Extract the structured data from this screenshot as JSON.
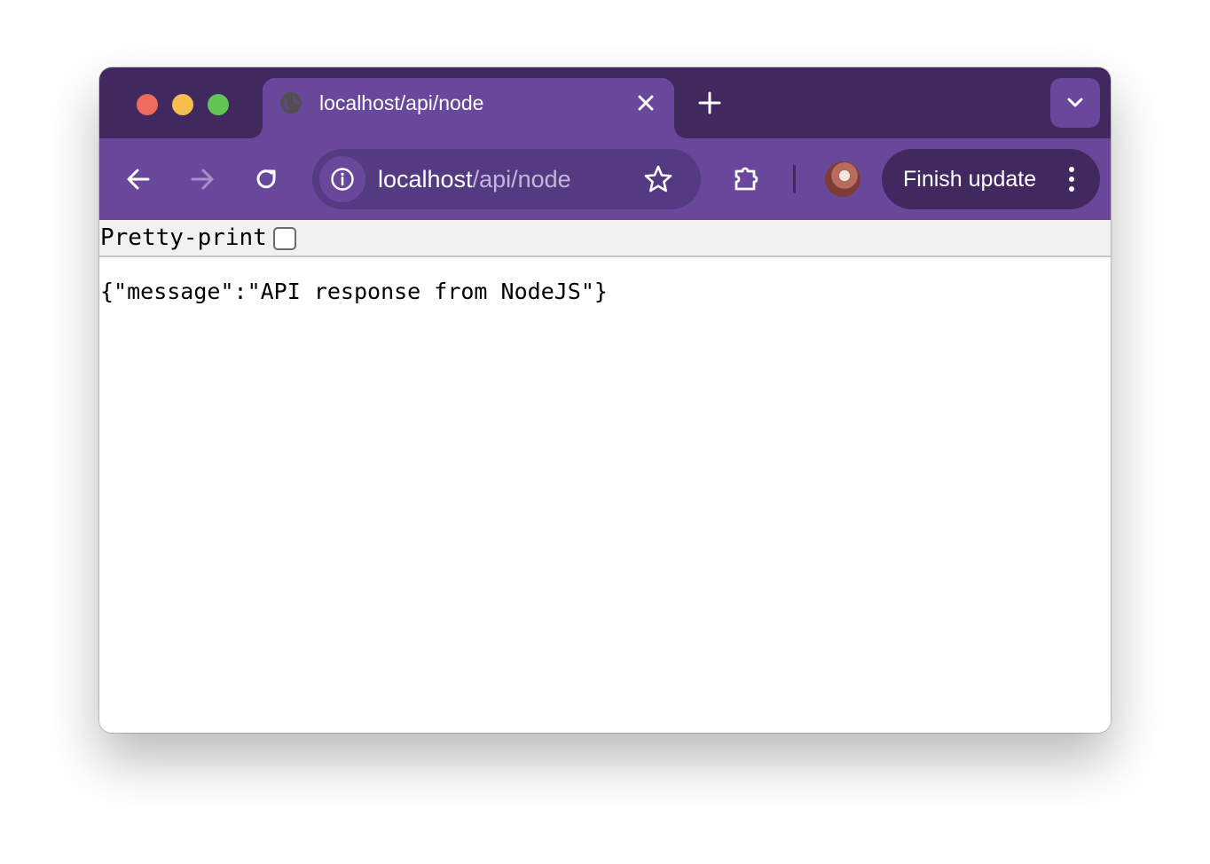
{
  "browser": {
    "tab": {
      "title": "localhost/api/node",
      "favicon": "globe-icon",
      "close_icon": "close-icon"
    },
    "new_tab_icon": "plus-icon",
    "tab_search_icon": "chevron-down-icon",
    "toolbar": {
      "back_icon": "arrow-left-icon",
      "forward_icon": "arrow-right-icon",
      "reload_icon": "reload-icon",
      "site_info_icon": "info-icon",
      "url_host": "localhost",
      "url_path": "/api/node",
      "bookmark_icon": "star-icon",
      "extensions_icon": "puzzle-icon",
      "profile_icon": "avatar",
      "update_button_label": "Finish update",
      "menu_icon": "vertical-dots-icon"
    },
    "colors": {
      "frame": "#41295f",
      "tab_active": "#69479b",
      "omnibox": "#543a81",
      "close": "#ec6a5e",
      "minimize": "#f4bf4f",
      "maximize": "#61c554"
    }
  },
  "page": {
    "pretty_print_label": "Pretty-print",
    "pretty_print_checked": false,
    "body_text": "{\"message\":\"API response from NodeJS\"}"
  }
}
